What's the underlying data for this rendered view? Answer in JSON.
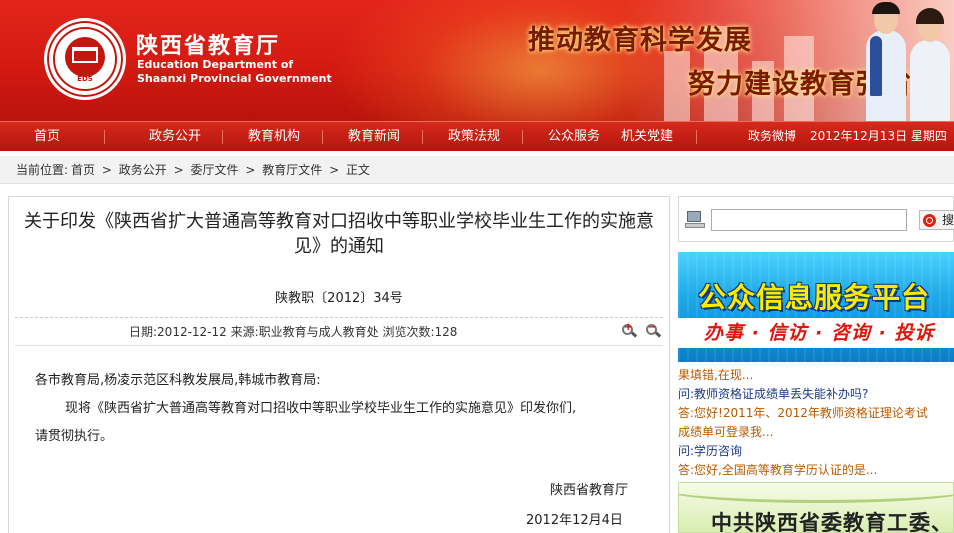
{
  "header": {
    "site_name_cn": "陕西省教育厅",
    "site_name_en_line1": "Education Department of",
    "site_name_en_line2": "Shaanxi Provincial Government",
    "seal_text": "EDS",
    "slogan_line1": "推动教育科学发展",
    "slogan_line2": "努力建设教育强省",
    "colors": {
      "brand_red": "#d41a12",
      "slogan": "#7a1a00"
    }
  },
  "nav": {
    "items": [
      "首页",
      "政务公开",
      "教育机构",
      "教育新闻",
      "政策法规",
      "公众服务",
      "机关党建"
    ],
    "weibo_label": "政务微博",
    "date_text": "2012年12月13日 星期四"
  },
  "breadcrumb": {
    "prefix": "当前位置:",
    "items": [
      "首页",
      "政务公开",
      "委厅文件",
      "教育厅文件",
      "正文"
    ],
    "separator": ">"
  },
  "article": {
    "title": "关于印发《陕西省扩大普通高等教育对口招收中等职业学校毕业生工作的实施意见》的通知",
    "doc_number": "陕教职〔2012〕34号",
    "meta": "日期:2012-12-12  来源:职业教育与成人教育处  浏览次数:128",
    "salutation": "各市教育局,杨凌示范区科教发展局,韩城市教育局:",
    "body_line1": "现将《陕西省扩大普通高等教育对口招收中等职业学校毕业生工作的实施意见》印发你们,",
    "body_line2": "请贯彻执行。",
    "signature": "陕西省教育厅",
    "signed_date": "2012年12月4日",
    "zoom_in_icon": "zoom-in-icon",
    "zoom_out_icon": "zoom-out-icon"
  },
  "sidebar": {
    "search": {
      "placeholder": "",
      "button_label": "搜"
    },
    "banner_title": "公众信息服务平台",
    "banner_subtitle": "办事 · 信访 · 咨询 · 投诉",
    "qa": [
      {
        "type": "a",
        "text": "果填错,在现..."
      },
      {
        "type": "q",
        "text": "问:教师资格证成绩单丢失能补办吗?"
      },
      {
        "type": "a",
        "text": "答:您好!2011年、2012年教师资格证理论考试"
      },
      {
        "type": "a",
        "text": "成绩单可登录我..."
      },
      {
        "type": "q",
        "text": "问:学历咨询"
      },
      {
        "type": "a",
        "text": "答:您好,全国高等教育学历认证的是..."
      }
    ],
    "bottom_banner": "中共陕西省委教育工委、"
  }
}
